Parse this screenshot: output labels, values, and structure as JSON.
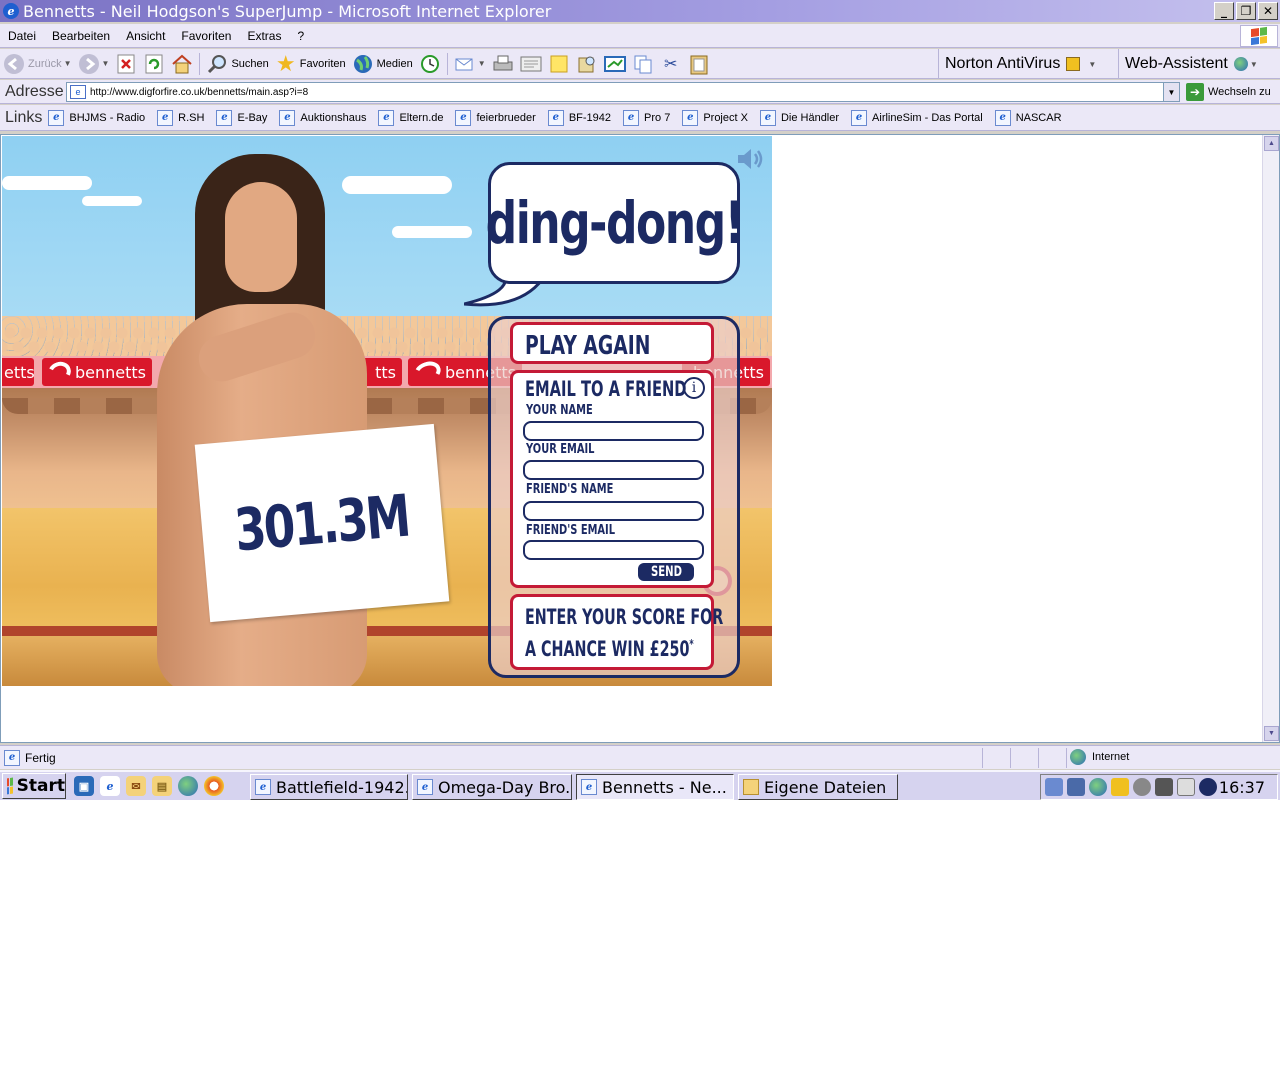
{
  "window": {
    "title": "Bennetts - Neil Hodgson's SuperJump - Microsoft Internet Explorer",
    "buttons": [
      "_",
      "❐",
      "✕"
    ]
  },
  "menu": [
    "Datei",
    "Bearbeiten",
    "Ansicht",
    "Favoriten",
    "Extras",
    "?"
  ],
  "toolbar": {
    "back": "Zurück",
    "search": "Suchen",
    "favorites": "Favoriten",
    "media": "Medien",
    "norton": "Norton AntiVirus",
    "webassistant": "Web-Assistent"
  },
  "address": {
    "label": "Adresse",
    "url": "http://www.digforfire.co.uk/bennetts/main.asp?i=8",
    "go": "Wechseln zu"
  },
  "links": {
    "label": "Links",
    "items": [
      "BHJMS - Radio",
      "R.SH",
      "E-Bay",
      "Auktionshaus",
      "Eltern.de",
      "feierbrueder",
      "BF-1942",
      "Pro 7",
      "Project X",
      "Die Händler",
      "AirlineSim - Das Portal",
      "NASCAR"
    ]
  },
  "game": {
    "bubble": "ding-dong!",
    "score": "301.3M",
    "ad_text": "bennetts",
    "ad_text_left": "etts",
    "ad_text_mid": "tts",
    "play_again": "PLAY AGAIN",
    "email_title": "EMAIL TO A FRIEND",
    "fields": {
      "your_name": "YOUR NAME",
      "your_email": "YOUR EMAIL",
      "friends_name": "FRIEND'S NAME",
      "friends_email": "FRIEND'S EMAIL"
    },
    "send": "SEND",
    "enter_line1": "ENTER YOUR SCORE FOR",
    "enter_line2": "A CHANCE WIN £250",
    "enter_asterisk": "*"
  },
  "status": {
    "text": "Fertig",
    "zone": "Internet"
  },
  "taskbar": {
    "start": "Start",
    "tasks": [
      "Battlefield-1942...",
      "Omega-Day Bro...",
      "Bennetts - Ne...",
      "Eigene Dateien"
    ],
    "clock": "16:37"
  },
  "colors": {
    "navy": "#1c2a63",
    "red": "#c41a36",
    "brand_red": "#d9182b"
  }
}
